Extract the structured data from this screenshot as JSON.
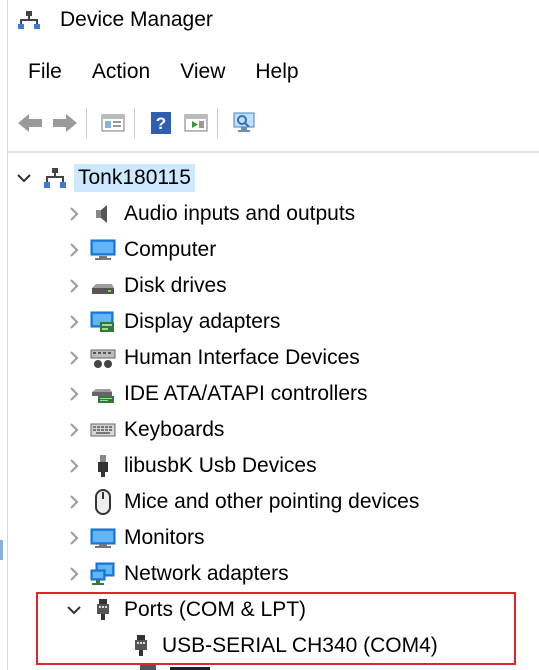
{
  "window": {
    "title": "Device Manager"
  },
  "menu": [
    "File",
    "Action",
    "View",
    "Help"
  ],
  "toolbar": [
    "back-icon",
    "forward-icon",
    "properties-icon",
    "help-icon",
    "run-icon",
    "scan-hardware-icon"
  ],
  "tree": {
    "root": "Tonk180115",
    "categories": [
      {
        "label": "Audio inputs and outputs",
        "icon": "speaker-icon"
      },
      {
        "label": "Computer",
        "icon": "computer-icon"
      },
      {
        "label": "Disk drives",
        "icon": "disk-drive-icon"
      },
      {
        "label": "Display adapters",
        "icon": "display-adapter-icon"
      },
      {
        "label": "Human Interface Devices",
        "icon": "hid-icon"
      },
      {
        "label": "IDE ATA/ATAPI controllers",
        "icon": "ide-controller-icon"
      },
      {
        "label": "Keyboards",
        "icon": "keyboard-icon"
      },
      {
        "label": "libusbK Usb Devices",
        "icon": "usb-plug-icon"
      },
      {
        "label": "Mice and other pointing devices",
        "icon": "mouse-icon"
      },
      {
        "label": "Monitors",
        "icon": "monitor-icon"
      },
      {
        "label": "Network adapters",
        "icon": "network-adapter-icon"
      }
    ],
    "ports": {
      "label": "Ports (COM & LPT)",
      "child": "USB-SERIAL CH340 (COM4)"
    }
  },
  "colors": {
    "selection": "#cde8ff",
    "highlight_border": "#e0262a"
  }
}
